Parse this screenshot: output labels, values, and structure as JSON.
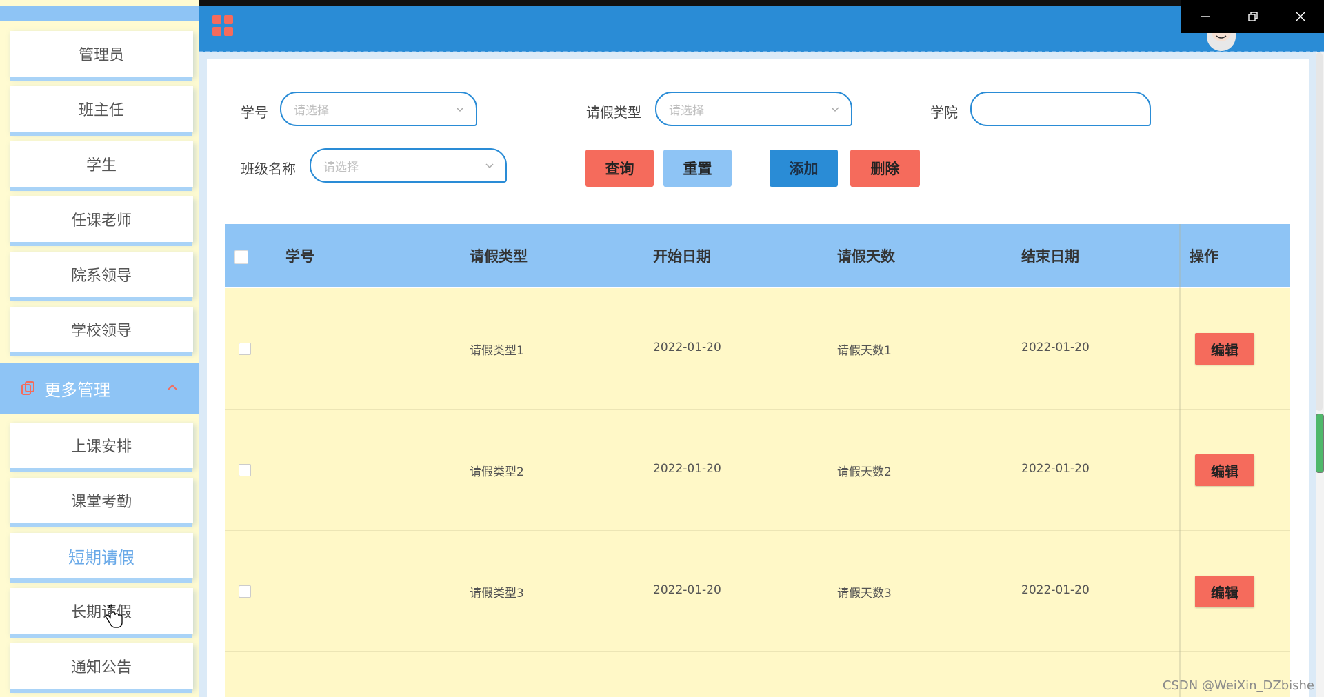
{
  "sidebar": {
    "items_top": [
      "管理员",
      "班主任",
      "学生",
      "任课老师",
      "院系领导",
      "学校领导"
    ],
    "group": {
      "label": "更多管理"
    },
    "items_sub": [
      "上课安排",
      "课堂考勤",
      "短期请假",
      "长期请假",
      "通知公告"
    ],
    "active_item": "短期请假"
  },
  "search": {
    "student_id_label": "学号",
    "student_id_placeholder": "请选择",
    "leave_type_label": "请假类型",
    "leave_type_placeholder": "请选择",
    "college_label": "学院",
    "college_value": "",
    "class_name_label": "班级名称",
    "class_name_placeholder": "请选择"
  },
  "actions": {
    "query": "查询",
    "reset": "重置",
    "add": "添加",
    "delete": "删除"
  },
  "table": {
    "columns": [
      "学号",
      "请假类型",
      "开始日期",
      "请假天数",
      "结束日期",
      "操作"
    ],
    "rows": [
      {
        "student_id": "",
        "leave_type": "请假类型1",
        "start_date": "2022-01-20",
        "days": "请假天数1",
        "end_date": "2022-01-20",
        "action": "编辑"
      },
      {
        "student_id": "",
        "leave_type": "请假类型2",
        "start_date": "2022-01-20",
        "days": "请假天数2",
        "end_date": "2022-01-20",
        "action": "编辑"
      },
      {
        "student_id": "",
        "leave_type": "请假类型3",
        "start_date": "2022-01-20",
        "days": "请假天数3",
        "end_date": "2022-01-20",
        "action": "编辑"
      }
    ]
  },
  "watermark": "CSDN @WeiXin_DZbishe",
  "colors": {
    "primary": "#2a8cd6",
    "light_blue": "#8ec4f5",
    "danger": "#f56b5c",
    "row_bg": "#fff8c7",
    "sidebar_bg": "#fffbd1"
  },
  "icons": [
    "grid-menu-icon",
    "window-minimize-icon",
    "window-restore-icon",
    "window-close-icon",
    "copy-icon",
    "chevron-up-icon",
    "chevron-down-icon",
    "hand-cursor-icon"
  ]
}
